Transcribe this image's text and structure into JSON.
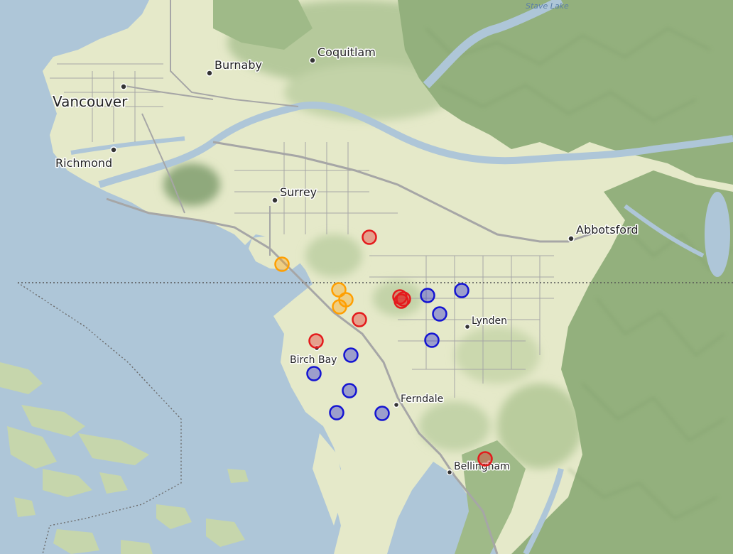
{
  "map": {
    "water_labels": [
      {
        "id": "stave-lake",
        "text": "Stave Lake"
      }
    ],
    "places": [
      {
        "id": "vancouver",
        "name": "Vancouver",
        "size": "large"
      },
      {
        "id": "burnaby",
        "name": "Burnaby",
        "size": "medium"
      },
      {
        "id": "coquitlam",
        "name": "Coquitlam",
        "size": "medium"
      },
      {
        "id": "richmond",
        "name": "Richmond",
        "size": "medium"
      },
      {
        "id": "surrey",
        "name": "Surrey",
        "size": "medium"
      },
      {
        "id": "abbotsford",
        "name": "Abbotsford",
        "size": "medium"
      },
      {
        "id": "lynden",
        "name": "Lynden",
        "size": "small"
      },
      {
        "id": "birch-bay",
        "name": "Birch Bay",
        "size": "small"
      },
      {
        "id": "ferndale",
        "name": "Ferndale",
        "size": "small"
      },
      {
        "id": "bellingham",
        "name": "Bellingham",
        "size": "small"
      }
    ],
    "marker_colors": {
      "red": "#e41a1c",
      "orange": "#ff9f00",
      "blue": "#1414d2"
    },
    "markers": [
      {
        "id": "m1",
        "color": "red"
      },
      {
        "id": "m2",
        "color": "orange"
      },
      {
        "id": "m3",
        "color": "orange"
      },
      {
        "id": "m4",
        "color": "orange"
      },
      {
        "id": "m5",
        "color": "orange"
      },
      {
        "id": "m6",
        "color": "red"
      },
      {
        "id": "m7",
        "color": "red"
      },
      {
        "id": "m8",
        "color": "red"
      },
      {
        "id": "m9",
        "color": "red"
      },
      {
        "id": "m10",
        "color": "blue"
      },
      {
        "id": "m11",
        "color": "blue"
      },
      {
        "id": "m12",
        "color": "blue"
      },
      {
        "id": "m13",
        "color": "blue"
      },
      {
        "id": "m14",
        "color": "red"
      },
      {
        "id": "m15",
        "color": "blue"
      },
      {
        "id": "m16",
        "color": "blue"
      },
      {
        "id": "m17",
        "color": "blue"
      },
      {
        "id": "m18",
        "color": "blue"
      },
      {
        "id": "m19",
        "color": "blue"
      },
      {
        "id": "m20",
        "color": "red"
      }
    ],
    "colors": {
      "water": "#aec6d8",
      "lowland": "#e3e8c4",
      "forest": "#b9cc9d",
      "mountain": "#8faf7c",
      "road": "#a8a8a8",
      "border": "#555555"
    }
  }
}
